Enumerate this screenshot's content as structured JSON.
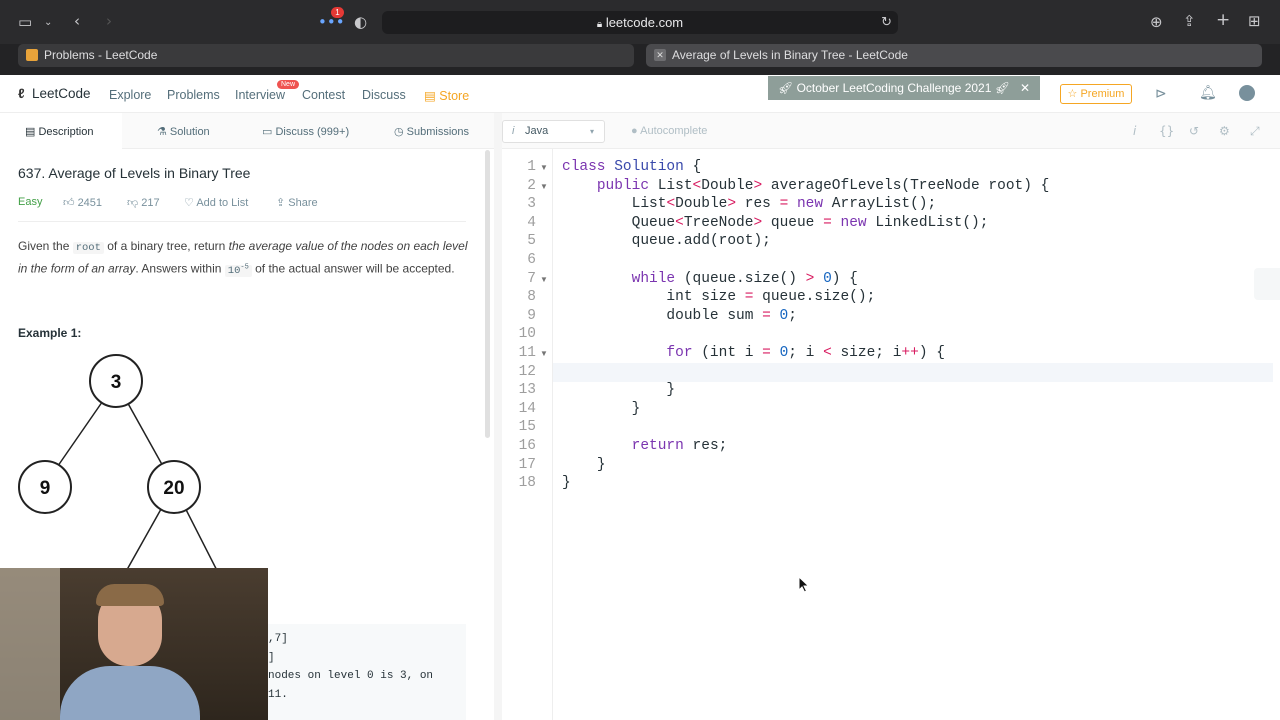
{
  "browser": {
    "url": "leetcode.com",
    "notification_count": "1",
    "tabs": [
      {
        "title": "Problems - LeetCode",
        "active": false
      },
      {
        "title": "Average of Levels in Binary Tree - LeetCode",
        "active": true
      }
    ]
  },
  "nav": {
    "logo": "LeetCode",
    "items": [
      "Explore",
      "Problems",
      "Interview",
      "Contest",
      "Discuss",
      "Store"
    ],
    "new_badge": "New",
    "banner": "October LeetCoding Challenge 2021",
    "premium": "Premium"
  },
  "left_tabs": [
    "Description",
    "Solution",
    "Discuss (999+)",
    "Submissions"
  ],
  "problem": {
    "title": "637. Average of Levels in Binary Tree",
    "difficulty": "Easy",
    "likes": "2451",
    "dislikes": "217",
    "add_to_list": "Add to List",
    "share": "Share",
    "desc_a": "Given the ",
    "desc_code": "root",
    "desc_b": " of a binary tree, return ",
    "desc_em": "the average value of the nodes on each level in the form of an array",
    "desc_c": ". Answers within ",
    "desc_exp": "10",
    "desc_sup": "-5",
    "desc_d": " of the actual answer will be accepted.",
    "example_title": "Example 1:",
    "tree_nodes": [
      "3",
      "9",
      "20"
    ],
    "example_lines": [
      ",7]",
      "]",
      "nodes on level 0 is 3, on",
      "11."
    ]
  },
  "editor": {
    "language": "Java",
    "autocomplete": "Autocomplete",
    "line_numbers": [
      "1",
      "2",
      "3",
      "4",
      "5",
      "6",
      "7",
      "8",
      "9",
      "10",
      "11",
      "12",
      "13",
      "14",
      "15",
      "16",
      "17",
      "18"
    ]
  },
  "colors": {
    "accent": "#f5a623",
    "easy": "#43a047",
    "banner": "#8e9e99"
  }
}
